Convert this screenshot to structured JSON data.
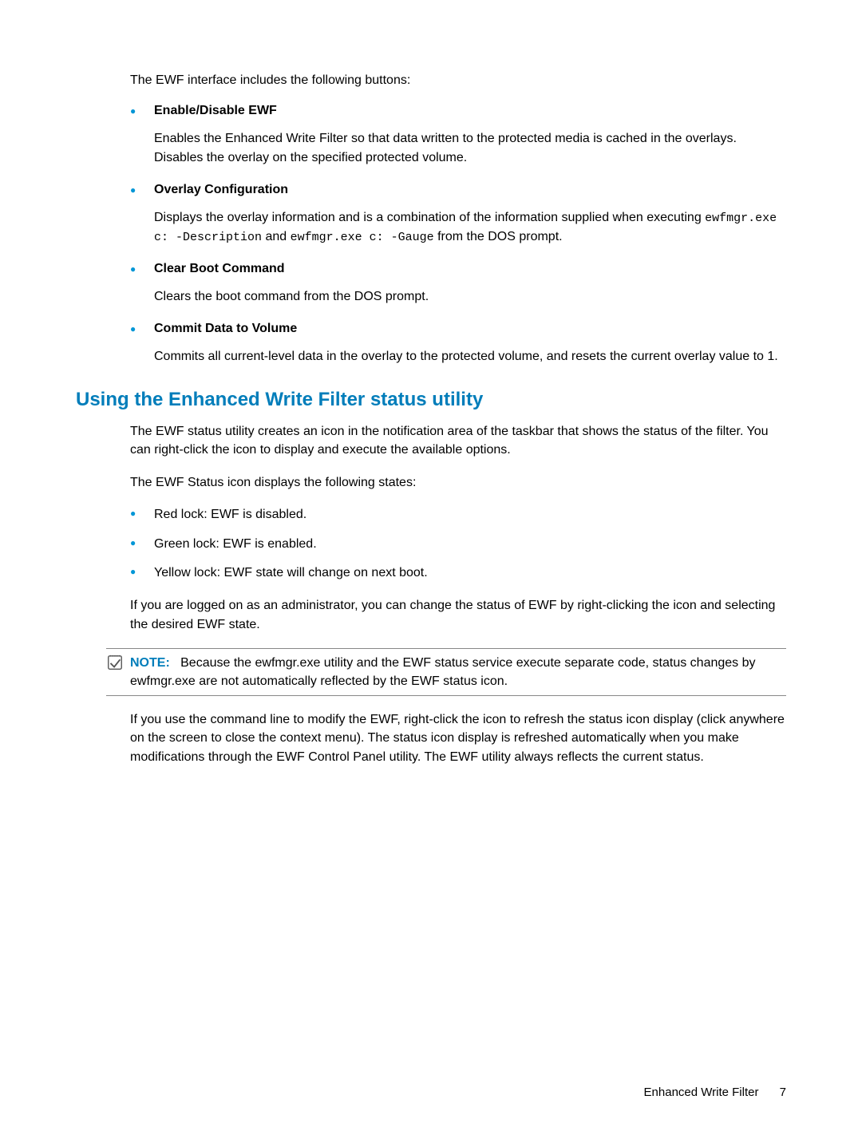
{
  "intro": "The EWF interface includes the following buttons:",
  "buttons": [
    {
      "title": "Enable/Disable EWF",
      "desc": "Enables the Enhanced Write Filter so that data written to the protected media is cached in the overlays. Disables the overlay on the specified protected volume."
    },
    {
      "title": "Overlay Configuration",
      "desc_pre": "Displays the overlay information and is a combination of the information supplied when executing ",
      "code1": "ewfmgr.exe c: -Description",
      "mid": " and ",
      "code2": "ewfmgr.exe c: -Gauge",
      "desc_post": " from the DOS prompt."
    },
    {
      "title": "Clear Boot Command",
      "desc": "Clears the boot command from the DOS prompt."
    },
    {
      "title": "Commit Data to Volume",
      "desc": "Commits all current-level data in the overlay to the protected volume, and resets the current overlay value to 1."
    }
  ],
  "section_heading": "Using the Enhanced Write Filter status utility",
  "section_p1": "The EWF status utility creates an icon in the notification area of the taskbar that shows the status of the filter. You can right-click the icon to display and execute the available options.",
  "section_p2": "The EWF Status icon displays the following states:",
  "states": [
    "Red lock: EWF is disabled.",
    "Green lock: EWF is enabled.",
    "Yellow lock: EWF state will change on next boot."
  ],
  "section_p3": "If you are logged on as an administrator, you can change the status of EWF by right-clicking the icon and selecting the desired EWF state.",
  "note_label": "NOTE:",
  "note_text": "Because the ewfmgr.exe utility and the EWF status service execute separate code, status changes by ewfmgr.exe are not automatically reflected by the EWF status icon.",
  "section_p4": "If you use the command line to modify the EWF, right-click the icon to refresh the status icon display (click anywhere on the screen to close the context menu). The status icon display is refreshed automatically when you make modifications through the EWF Control Panel utility. The EWF utility always reflects the current status.",
  "footer_text": "Enhanced Write Filter",
  "footer_page": "7"
}
